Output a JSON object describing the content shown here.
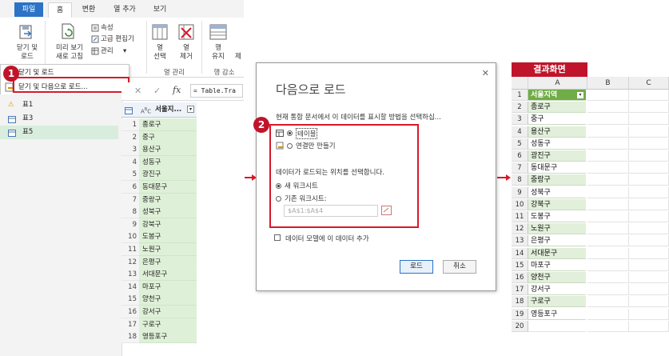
{
  "editor": {
    "tabs": [
      "파일",
      "홈",
      "변환",
      "열 추가",
      "보기"
    ],
    "ribbon": {
      "close_load": "닫기 및\n로드",
      "refresh_preview": "미리 보기\n새로 고침",
      "properties": "속성",
      "advanced_editor": "고급 편집기",
      "manage": "관리",
      "select_columns": "열\n선택",
      "remove_columns": "열\n제거",
      "keep_rows": "행\n유지",
      "remove_rows": "제",
      "group_columns": "열 관리",
      "group_rows": "행 감소"
    },
    "dropdown": {
      "close_load": "닫기 및 로드",
      "close_load_to": "닫기 및 다음으로 로드..."
    },
    "queries": [
      "표1",
      "표3",
      "표5"
    ],
    "formula_prefix": "fx",
    "formula": "= Table.Tra",
    "column_header": "서울지...",
    "rows": [
      "종로구",
      "중구",
      "용산구",
      "성동구",
      "광진구",
      "동대문구",
      "중랑구",
      "성북구",
      "강북구",
      "도봉구",
      "노원구",
      "은평구",
      "서대문구",
      "마포구",
      "양천구",
      "강서구",
      "구로구",
      "영등포구"
    ]
  },
  "badges": {
    "one": "1",
    "two": "2"
  },
  "dialog": {
    "title": "다음으로 로드",
    "prompt": "현재 통합 문서에서 이 데이터를 표시할 방법을 선택하십...",
    "opt_table": "테이블",
    "opt_connection": "연결만 만들기",
    "location_prompt": "데이터가 로드되는 위치를 선택합니다.",
    "opt_new_sheet": "새 워크시트",
    "opt_existing_sheet": "기존 워크시트:",
    "range_value": "$A$1:$A$4",
    "add_model": "데이터 모델에 이 데이터 추가",
    "load_button": "로드",
    "cancel_button": "취소"
  },
  "result": {
    "label": "결과화면",
    "columns": [
      "A",
      "B",
      "C"
    ],
    "header": "서울지역",
    "rows": [
      "종로구",
      "중구",
      "용산구",
      "성동구",
      "광진구",
      "동대문구",
      "중랑구",
      "성북구",
      "강북구",
      "도봉구",
      "노원구",
      "은평구",
      "서대문구",
      "마포구",
      "양천구",
      "강서구",
      "구로구",
      "영등포구"
    ],
    "row_numbers": [
      "1",
      "2",
      "3",
      "4",
      "5",
      "6",
      "7",
      "8",
      "9",
      "10",
      "11",
      "12",
      "13",
      "14",
      "15",
      "16",
      "17",
      "18",
      "19",
      "20"
    ]
  },
  "colors": {
    "accent_red": "#d9182b",
    "file_tab": "#2a73c6",
    "table_header": "#70ad47",
    "table_band": "#e2efda"
  }
}
